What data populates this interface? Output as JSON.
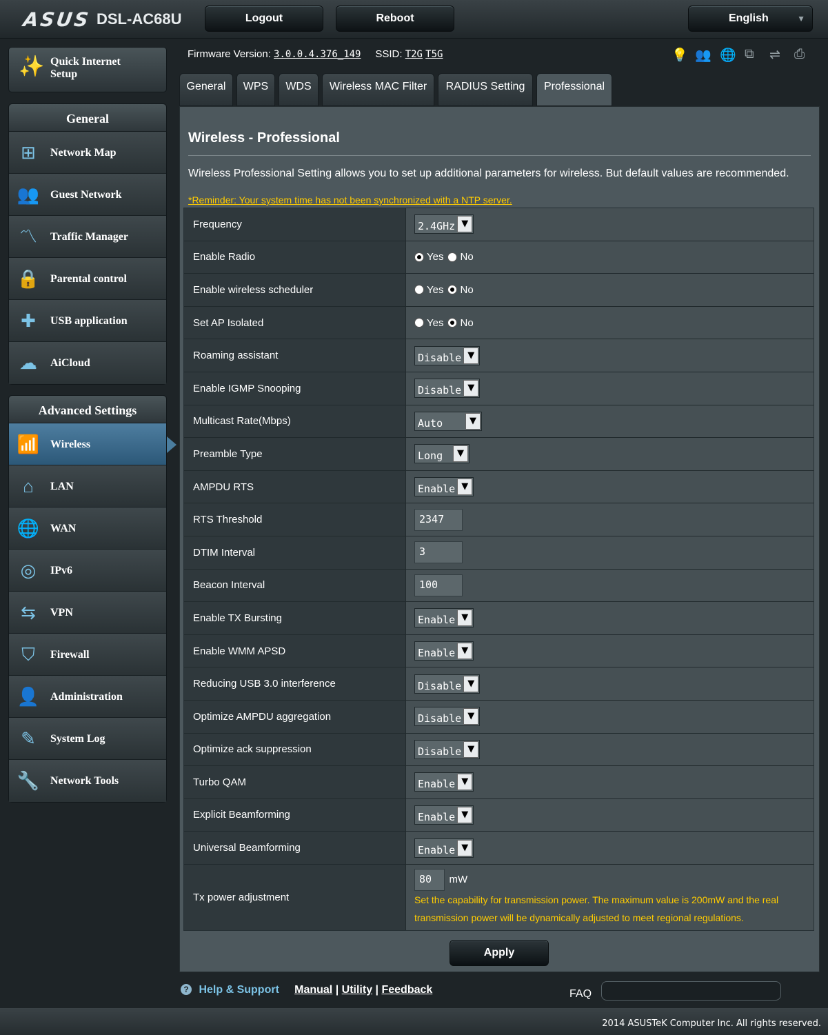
{
  "header": {
    "brand": "ASUS",
    "model": "DSL-AC68U",
    "logout_label": "Logout",
    "reboot_label": "Reboot",
    "language": "English"
  },
  "status": {
    "firmware_label": "Firmware Version:",
    "firmware_value": "3.0.0.4.376_149",
    "ssid_label": "SSID:",
    "ssid_24": "T2G",
    "ssid_5": "T5G",
    "icons": [
      "bulb-icon",
      "user-icon",
      "globe-icon",
      "monitors-icon",
      "usb-icon",
      "printer-icon"
    ]
  },
  "sidebar": {
    "quick_setup_label_1": "Quick Internet",
    "quick_setup_label_2": "Setup",
    "general_header": "General",
    "general_items": [
      {
        "label": "Network Map",
        "icon": "network-map-icon"
      },
      {
        "label": "Guest Network",
        "icon": "guest-network-icon"
      },
      {
        "label": "Traffic Manager",
        "icon": "traffic-icon"
      },
      {
        "label": "Parental control",
        "icon": "lock-icon"
      },
      {
        "label": "USB application",
        "icon": "puzzle-icon"
      },
      {
        "label": "AiCloud",
        "icon": "cloud-icon"
      }
    ],
    "advanced_header": "Advanced Settings",
    "advanced_items": [
      {
        "label": "Wireless",
        "icon": "wifi-icon"
      },
      {
        "label": "LAN",
        "icon": "home-icon"
      },
      {
        "label": "WAN",
        "icon": "globe-icon"
      },
      {
        "label": "IPv6",
        "icon": "ipv6-icon"
      },
      {
        "label": "VPN",
        "icon": "vpn-icon"
      },
      {
        "label": "Firewall",
        "icon": "shield-icon"
      },
      {
        "label": "Administration",
        "icon": "admin-icon"
      },
      {
        "label": "System Log",
        "icon": "log-icon"
      },
      {
        "label": "Network Tools",
        "icon": "tools-icon"
      }
    ]
  },
  "tabs": [
    "General",
    "WPS",
    "WDS",
    "Wireless MAC Filter",
    "RADIUS Setting",
    "Professional"
  ],
  "main": {
    "title": "Wireless - Professional",
    "description": "Wireless Professional Setting allows you to set up additional parameters for wireless. But default values are recommended.",
    "reminder": "*Reminder: Your system time has not been synchronized with a NTP server.",
    "yes": "Yes",
    "no": "No",
    "rows": [
      {
        "label": "Frequency",
        "value": "2.4GHz"
      },
      {
        "label": "Enable Radio"
      },
      {
        "label": "Enable wireless scheduler"
      },
      {
        "label": "Set AP Isolated"
      },
      {
        "label": "Roaming assistant",
        "value": "Disable"
      },
      {
        "label": "Enable IGMP Snooping",
        "value": "Disable"
      },
      {
        "label": "Multicast Rate(Mbps)",
        "value": "Auto"
      },
      {
        "label": "Preamble Type",
        "value": "Long"
      },
      {
        "label": "AMPDU RTS",
        "value": "Enable"
      },
      {
        "label": "RTS Threshold",
        "value": "2347"
      },
      {
        "label": "DTIM Interval",
        "value": "3"
      },
      {
        "label": "Beacon Interval",
        "value": "100"
      },
      {
        "label": "Enable TX Bursting",
        "value": "Enable"
      },
      {
        "label": "Enable WMM APSD",
        "value": "Enable"
      },
      {
        "label": "Reducing USB 3.0 interference",
        "value": "Disable"
      },
      {
        "label": "Optimize AMPDU aggregation",
        "value": "Disable"
      },
      {
        "label": "Optimize ack suppression",
        "value": "Disable"
      },
      {
        "label": "Turbo QAM",
        "value": "Enable"
      },
      {
        "label": "Explicit Beamforming",
        "value": "Enable"
      },
      {
        "label": "Universal Beamforming",
        "value": "Enable"
      },
      {
        "label": "Tx power adjustment",
        "value": "80",
        "unit": "mW",
        "note": "Set the capability for transmission power. The maximum value is 200mW and the real transmission power will be dynamically adjusted to meet regional regulations."
      }
    ],
    "apply_label": "Apply"
  },
  "footer": {
    "help_label": "Help & Support",
    "manual": "Manual",
    "utility": "Utility",
    "feedback": "Feedback",
    "sep": "|",
    "faq": "FAQ",
    "copyright": "2014 ASUSTeK Computer Inc. All rights reserved."
  },
  "colors": {
    "accent": "#7cc3e6",
    "warning": "#ffcc00",
    "panel": "#4d585d",
    "active_menu": "#4a7d9f"
  }
}
